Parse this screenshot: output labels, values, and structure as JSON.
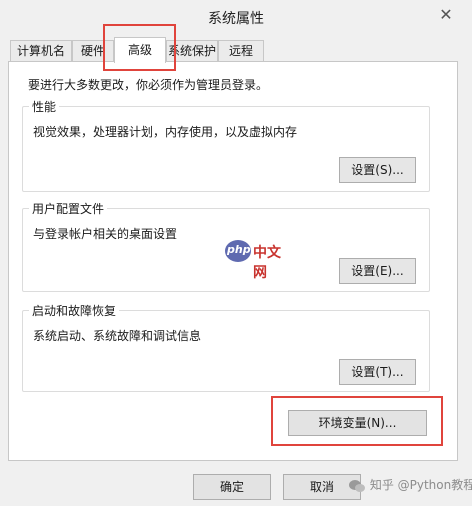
{
  "window": {
    "title": "系统属性",
    "close": "✕"
  },
  "tabs": [
    "计算机名",
    "硬件",
    "高级",
    "系统保护",
    "远程"
  ],
  "admin_note": "要进行大多数更改，你必须作为管理员登录。",
  "performance": {
    "label": "性能",
    "desc": "视觉效果，处理器计划，内存使用，以及虚拟内存",
    "button": "设置(S)..."
  },
  "user_profiles": {
    "label": "用户配置文件",
    "desc": "与登录帐户相关的桌面设置",
    "button": "设置(E)..."
  },
  "startup": {
    "label": "启动和故障恢复",
    "desc": "系统启动、系统故障和调试信息",
    "button": "设置(T)..."
  },
  "env_button": "环境变量(N)...",
  "ok": "确定",
  "cancel": "取消",
  "watermark_logo": "php",
  "watermark_cn": "中文网",
  "bottom_watermark": "知乎 @Python教程",
  "colors": {
    "highlight": "#e0443c",
    "watermark_logo": "#5f6ab0"
  },
  "icons": [
    "close-icon",
    "php-watermark-logo",
    "wechat-icon"
  ]
}
